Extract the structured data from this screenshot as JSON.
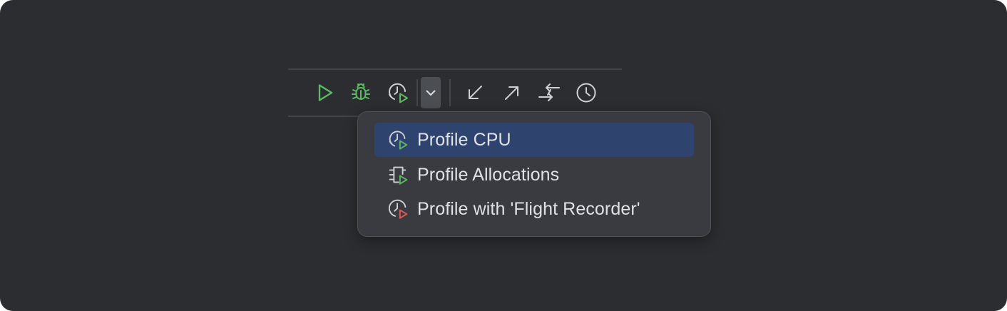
{
  "toolbar": {
    "buttons": [
      {
        "icon": "run-icon",
        "color": "#5fb865"
      },
      {
        "icon": "debug-bug-icon",
        "color": "#5fb865"
      },
      {
        "icon": "profile-icon",
        "color": "#ced0d6"
      },
      {
        "icon": "chevron-down-icon",
        "color": "#ced0d6"
      },
      {
        "icon": "arrow-down-left-icon",
        "color": "#ced0d6"
      },
      {
        "icon": "arrow-up-right-icon",
        "color": "#ced0d6"
      },
      {
        "icon": "compare-arrows-icon",
        "color": "#ced0d6"
      },
      {
        "icon": "clock-history-icon",
        "color": "#ced0d6"
      }
    ]
  },
  "menu": {
    "items": [
      {
        "label": "Profile CPU",
        "icon": "profile-cpu-icon",
        "selected": true
      },
      {
        "label": "Profile Allocations",
        "icon": "profile-allocations-icon",
        "selected": false
      },
      {
        "label": "Profile with 'Flight Recorder'",
        "icon": "flight-recorder-icon",
        "selected": false
      }
    ]
  },
  "colors": {
    "background": "#2b2d30",
    "popup": "#393b40",
    "selection": "#2e436e",
    "green_accent": "#5fb865",
    "red_accent": "#e55757",
    "text": "#dfe1e5"
  }
}
